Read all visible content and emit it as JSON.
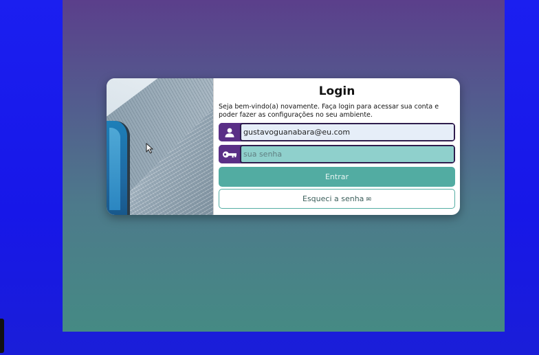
{
  "login": {
    "title": "Login",
    "subtitle": "Seja bem-vindo(a) novamente. Faça login para acessar sua conta e poder fazer as configurações no seu ambiente.",
    "email": {
      "icon": "user-icon",
      "value": "gustavoguanabara@eu.com"
    },
    "password": {
      "icon": "key-icon",
      "placeholder": "sua senha",
      "value": ""
    },
    "submit_label": "Entrar",
    "forgot_label": "Esqueci a senha",
    "forgot_icon": "envelope-icon"
  },
  "colors": {
    "accent_purple": "#5a2f86",
    "accent_teal": "#52aca2",
    "outer_background": "#1b1ff0"
  }
}
